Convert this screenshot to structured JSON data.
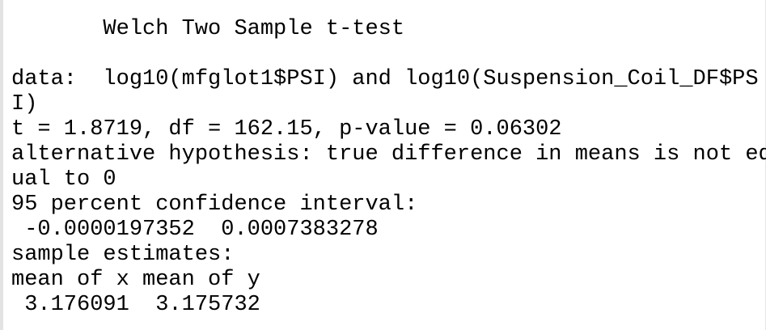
{
  "console_output": {
    "lines": [
      "       Welch Two Sample t-test",
      "",
      "data:  log10(mfglot1$PSI) and log10(Suspension_Coil_DF$PS",
      "I)",
      "t = 1.8719, df = 162.15, p-value = 0.06302",
      "alternative hypothesis: true difference in means is not eq",
      "ual to 0",
      "95 percent confidence interval:",
      " -0.0000197352  0.0007383278",
      "sample estimates:",
      "mean of x mean of y",
      " 3.176091  3.175732"
    ]
  }
}
